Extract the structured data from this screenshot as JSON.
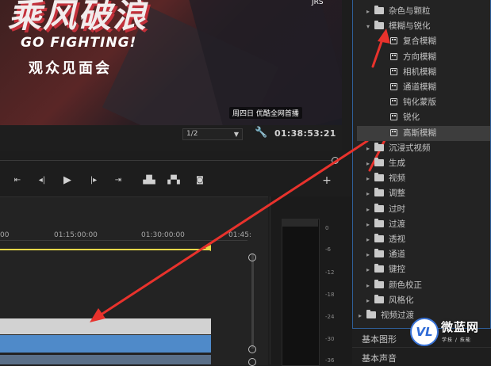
{
  "preview": {
    "logo_text": "乘风破浪",
    "slogan": "GO FIGHTING!",
    "event_text": "观众见面会",
    "broadcast_text": "周四日 优酷全网首播",
    "corner_text": "JRS"
  },
  "controls": {
    "quality": "1/2",
    "timecode": "01:38:53:21"
  },
  "timeline": {
    "ruler": [
      "00",
      "01:15:00:00",
      "01:30:00:00",
      "01:45:"
    ]
  },
  "meter": {
    "ticks": [
      "0",
      "-6",
      "-12",
      "-18",
      "-24",
      "-30",
      "-36"
    ]
  },
  "effects_tree": [
    {
      "label": "杂色与颗粒",
      "type": "folder",
      "expanded": false
    },
    {
      "label": "模糊与锐化",
      "type": "folder",
      "expanded": true
    },
    {
      "label": "复合模糊",
      "type": "effect"
    },
    {
      "label": "方向模糊",
      "type": "effect"
    },
    {
      "label": "相机模糊",
      "type": "effect"
    },
    {
      "label": "通道模糊",
      "type": "effect"
    },
    {
      "label": "钝化蒙版",
      "type": "effect"
    },
    {
      "label": "锐化",
      "type": "effect"
    },
    {
      "label": "高斯模糊",
      "type": "effect",
      "selected": true
    },
    {
      "label": "沉浸式视频",
      "type": "folder",
      "expanded": false
    },
    {
      "label": "生成",
      "type": "folder",
      "expanded": false
    },
    {
      "label": "视频",
      "type": "folder",
      "expanded": false
    },
    {
      "label": "调整",
      "type": "folder",
      "expanded": false
    },
    {
      "label": "过时",
      "type": "folder",
      "expanded": false
    },
    {
      "label": "过渡",
      "type": "folder",
      "expanded": false
    },
    {
      "label": "透视",
      "type": "folder",
      "expanded": false
    },
    {
      "label": "通道",
      "type": "folder",
      "expanded": false
    },
    {
      "label": "键控",
      "type": "folder",
      "expanded": false
    },
    {
      "label": "颜色校正",
      "type": "folder",
      "expanded": false
    },
    {
      "label": "风格化",
      "type": "folder",
      "expanded": false
    },
    {
      "label": "视频过渡",
      "type": "folder",
      "expanded": false
    }
  ],
  "bottom_panels": [
    "基本图形",
    "基本声音"
  ],
  "watermark": {
    "logo": "VL",
    "name": "微蓝网",
    "sub": "学技 / 技能"
  },
  "colors": {
    "accent_blue": "#2f5f9a",
    "arrow_red": "#e8322c",
    "work_area_yellow": "#e7d84a",
    "audio_clip_blue": "#4f8ac9"
  }
}
